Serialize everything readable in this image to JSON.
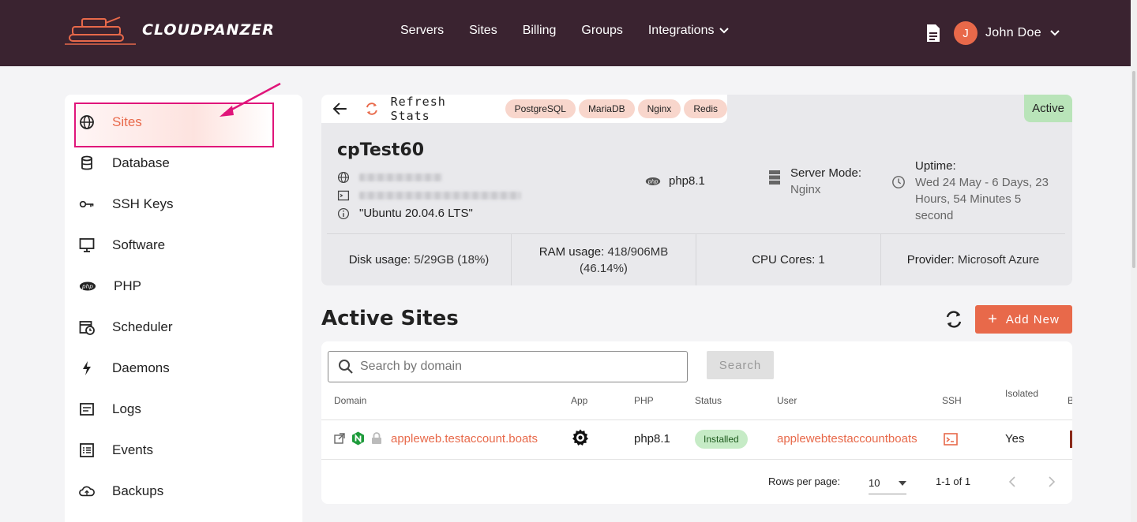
{
  "brand": {
    "name": "CLOUDPANZER"
  },
  "nav": [
    {
      "label": "Servers"
    },
    {
      "label": "Sites"
    },
    {
      "label": "Billing"
    },
    {
      "label": "Groups"
    },
    {
      "label": "Integrations"
    }
  ],
  "user": {
    "initial": "J",
    "name": "John Doe"
  },
  "sidebar": {
    "items": [
      {
        "label": "Sites",
        "icon": "globe-icon",
        "active": true
      },
      {
        "label": "Database",
        "icon": "database-icon"
      },
      {
        "label": "SSH Keys",
        "icon": "key-icon"
      },
      {
        "label": "Software",
        "icon": "monitor-icon"
      },
      {
        "label": "PHP",
        "icon": "php-icon"
      },
      {
        "label": "Scheduler",
        "icon": "calendar-clock-icon"
      },
      {
        "label": "Daemons",
        "icon": "bolt-icon"
      },
      {
        "label": "Logs",
        "icon": "logs-icon"
      },
      {
        "label": "Events",
        "icon": "events-icon"
      },
      {
        "label": "Backups",
        "icon": "cloud-upload-icon"
      }
    ]
  },
  "server": {
    "refresh_label": "Refresh Stats",
    "chips": [
      "PostgreSQL",
      "MariaDB",
      "Nginx",
      "Redis"
    ],
    "status": "Active",
    "name": "cpTest60",
    "os": "\"Ubuntu 20.04.6 LTS\"",
    "php": "php8.1",
    "mode_label": "Server Mode:",
    "mode_value": "Nginx",
    "uptime_label": "Uptime:",
    "uptime_value": "Wed 24 May - 6 Days, 23 Hours, 54 Minutes 5 second",
    "stats": {
      "disk_label": "Disk usage:",
      "disk_value": "5/29GB (18%)",
      "ram_label": "RAM usage:",
      "ram_value": "418/906MB",
      "ram_pct": "(46.14%)",
      "cpu_label": "CPU Cores:",
      "cpu_value": "1",
      "provider_label": "Provider:",
      "provider_value": "Microsoft Azure"
    }
  },
  "sites": {
    "title": "Active Sites",
    "add_label": "Add New",
    "search_placeholder": "Search by domain",
    "search_button": "Search",
    "columns": [
      "Domain",
      "App",
      "PHP",
      "Status",
      "User",
      "SSH",
      "Isolated",
      "B"
    ],
    "rows": [
      {
        "domain": "appleweb.testaccount.boats",
        "php": "php8.1",
        "status": "Installed",
        "user": "applewebtestaccountboats",
        "isolated": "Yes"
      }
    ],
    "pagination": {
      "rows_per_page_label": "Rows per page:",
      "rows_per_page": "10",
      "range": "1-1 of 1"
    }
  },
  "colors": {
    "header_bg": "#3a2330",
    "accent": "#e8694a",
    "active_green": "#b9e4b9",
    "annotation": "#e0157a"
  }
}
